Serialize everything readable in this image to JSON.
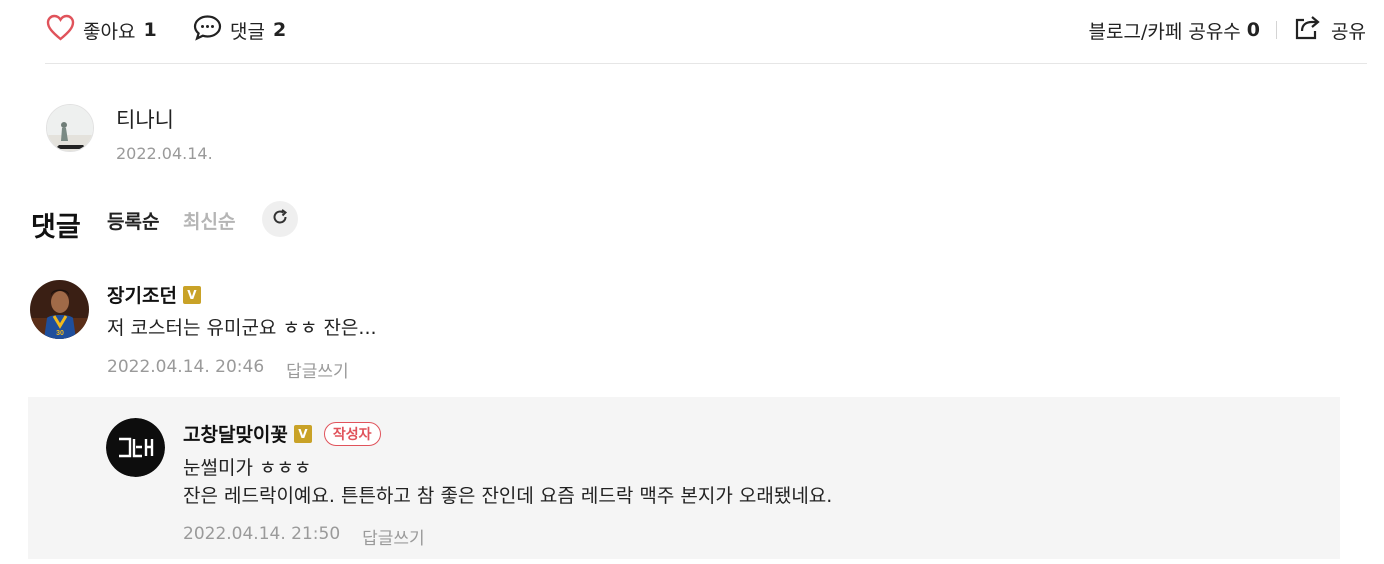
{
  "actions": {
    "like_label": "좋아요",
    "like_count": "1",
    "comment_label": "댓글",
    "comment_count": "2",
    "share_count_label": "블로그/카페 공유수",
    "share_count": "0",
    "share_label": "공유"
  },
  "author": {
    "name": "티나니",
    "date": "2022.04.14."
  },
  "comments_header": {
    "title": "댓글",
    "sort_registered": "등록순",
    "sort_latest": "최신순"
  },
  "comments": [
    {
      "name": "장기조던",
      "badge": "V",
      "text": "저 코스터는 유미군요 ㅎㅎ 잔은...",
      "date": "2022.04.14. 20:46",
      "reply_label": "답글쓰기"
    }
  ],
  "reply": {
    "name": "고창달맞이꽃",
    "badge": "V",
    "author_tag": "작성자",
    "avatar_text": "고달",
    "line1": "눈썰미가 ㅎㅎㅎ",
    "line2": "잔은 레드락이예요. 튼튼하고 참 좋은 잔인데 요즘 레드락 맥주 본지가 오래됐네요.",
    "date": "2022.04.14. 21:50",
    "reply_label": "답글쓰기"
  },
  "colors": {
    "heart": "#e0535b",
    "badge_gold": "#c9a227",
    "author_tag": "#e0535b"
  }
}
